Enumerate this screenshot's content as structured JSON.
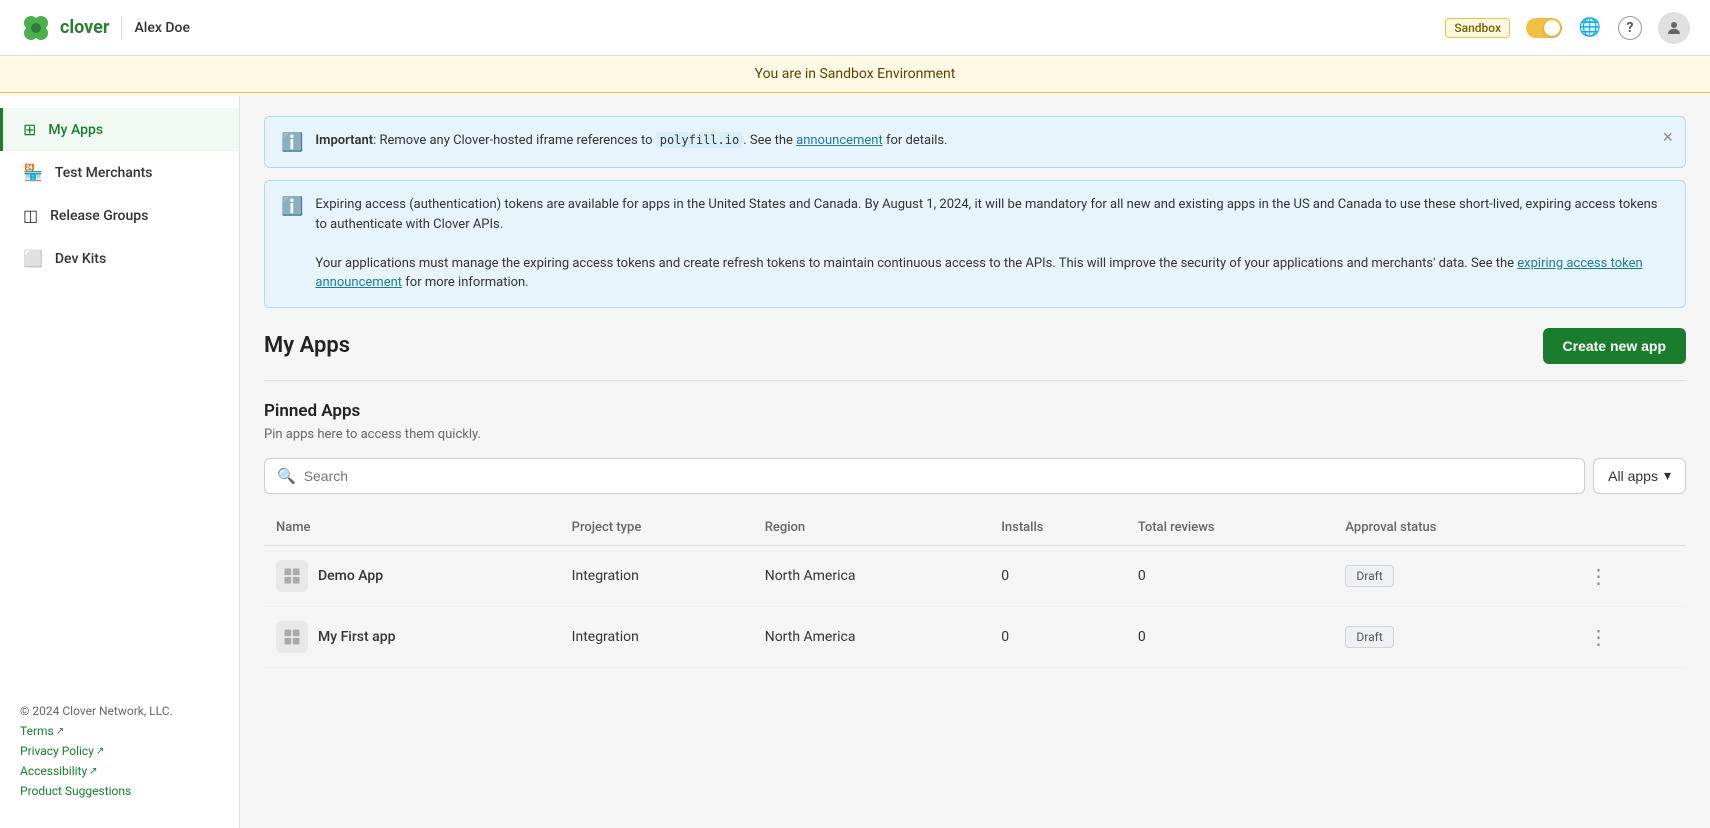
{
  "topNav": {
    "logoAlt": "Clover",
    "userName": "Alex Doe",
    "sandboxLabel": "Sandbox",
    "globeIcon": "🌐",
    "helpIcon": "?",
    "avatarIcon": "👤"
  },
  "sandboxBanner": {
    "text": "You are in Sandbox Environment"
  },
  "sidebar": {
    "items": [
      {
        "id": "my-apps",
        "label": "My Apps",
        "icon": "⊞",
        "active": true
      },
      {
        "id": "test-merchants",
        "label": "Test Merchants",
        "icon": "🏪",
        "active": false
      },
      {
        "id": "release-groups",
        "label": "Release Groups",
        "icon": "◫",
        "active": false
      },
      {
        "id": "dev-kits",
        "label": "Dev Kits",
        "icon": "⬜",
        "active": false
      }
    ],
    "footer": {
      "copyright": "© 2024 Clover Network, LLC.",
      "links": [
        {
          "label": "Terms",
          "external": true
        },
        {
          "label": "Privacy Policy",
          "external": true
        },
        {
          "label": "Accessibility",
          "external": true
        },
        {
          "label": "Product Suggestions",
          "external": false
        }
      ]
    }
  },
  "alerts": [
    {
      "id": "alert-1",
      "text_prefix": "",
      "strong": "Important",
      "text": ": Remove any Clover-hosted iframe references to ",
      "code": "polyfill.io",
      "text2": ". See the ",
      "link": "announcement",
      "text3": " for details.",
      "closeable": true
    },
    {
      "id": "alert-2",
      "body": "Expiring access (authentication) tokens are available for apps in the United States and Canada. By August 1, 2024, it will be mandatory for all new and existing apps in the US and Canada to use these short-lived, expiring access tokens to authenticate with Clover APIs.\nYour applications must manage the expiring access tokens and create refresh tokens to maintain continuous access to the APIs. This will improve the security of your applications and merchants' data. See the ",
      "link": "expiring access token announcement",
      "body2": " for more information.",
      "closeable": false
    }
  ],
  "pageTitle": "My Apps",
  "createButton": "Create new app",
  "pinnedSection": {
    "title": "Pinned Apps",
    "subtitle": "Pin apps here to access them quickly."
  },
  "search": {
    "placeholder": "Search"
  },
  "filter": {
    "label": "All apps"
  },
  "table": {
    "columns": [
      "Name",
      "Project type",
      "Region",
      "Installs",
      "Total reviews",
      "Approval status"
    ],
    "rows": [
      {
        "name": "Demo App",
        "projectType": "Integration",
        "region": "North America",
        "installs": "0",
        "totalReviews": "0",
        "approvalStatus": "Draft"
      },
      {
        "name": "My First app",
        "projectType": "Integration",
        "region": "North America",
        "installs": "0",
        "totalReviews": "0",
        "approvalStatus": "Draft"
      }
    ]
  }
}
